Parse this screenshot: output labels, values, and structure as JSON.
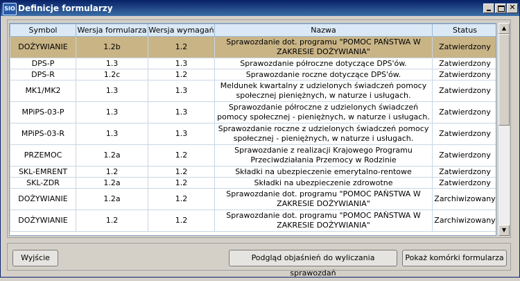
{
  "window": {
    "title": "Definicje formularzy",
    "icon": "SIO"
  },
  "table": {
    "columns": [
      "Symbol",
      "Wersja formularza",
      "Wersja wymagań",
      "Nazwa",
      "Status"
    ],
    "rows": [
      {
        "symbol": "DOŻYWIANIE",
        "wf": "1.2b",
        "ww": "1.2",
        "name": "Sprawozdanie dot. programu \"POMOC PAŃSTWA W ZAKRESIE DOŻYWIANIA\"",
        "status": "Zatwierdzony",
        "selected": true
      },
      {
        "symbol": "DPS-P",
        "wf": "1.3",
        "ww": "1.3",
        "name": "Sprawozdanie półroczne dotyczące DPS'ów.",
        "status": "Zatwierdzony"
      },
      {
        "symbol": "DPS-R",
        "wf": "1.2c",
        "ww": "1.2",
        "name": "Sprawozdanie roczne dotyczące DPS'ów.",
        "status": "Zatwierdzony"
      },
      {
        "symbol": "MK1/MK2",
        "wf": "1.3",
        "ww": "1.3",
        "name": "Meldunek kwartalny z udzielonych świadczeń pomocy społecznej pieniężnych, w naturze i usługach.",
        "status": "Zatwierdzony"
      },
      {
        "symbol": "MPiPS-03-P",
        "wf": "1.3",
        "ww": "1.3",
        "name": "Sprawozdanie półroczne z udzielonych świadczeń pomocy społecznej - pieniężnych, w naturze i usługach.",
        "status": "Zatwierdzony"
      },
      {
        "symbol": "MPiPS-03-R",
        "wf": "1.3",
        "ww": "1.3",
        "name": "Sprawozdanie roczne z udzielonych świadczeń pomocy społecznej - pieniężnych, w naturze i usługach.",
        "status": "Zatwierdzony"
      },
      {
        "symbol": "PRZEMOC",
        "wf": "1.2a",
        "ww": "1.2",
        "name": "Sprawozdanie z realizacji Krajowego Programu Przeciwdziałania Przemocy w Rodzinie",
        "status": "Zatwierdzony"
      },
      {
        "symbol": "SKL-EMRENT",
        "wf": "1.2",
        "ww": "1.2",
        "name": "Składki na ubezpieczenie emerytalno-rentowe",
        "status": "Zatwierdzony"
      },
      {
        "symbol": "SKL-ZDR",
        "wf": "1.2a",
        "ww": "1.2",
        "name": "Składki na ubezpieczenie zdrowotne",
        "status": "Zatwierdzony"
      },
      {
        "symbol": "DOŻYWIANIE",
        "wf": "1.2a",
        "ww": "1.2",
        "name": "Sprawozdanie dot. programu \"POMOC PAŃSTWA W ZAKRESIE DOŻYWIANIA\"",
        "status": "Zarchiwizowany"
      },
      {
        "symbol": "DOŻYWIANIE",
        "wf": "1.2",
        "ww": "1.2",
        "name": "Sprawozdanie dot. programu \"POMOC PAŃSTWA W ZAKRESIE DOŻYWIANIA\"",
        "status": "Zarchiwizowany"
      }
    ]
  },
  "buttons": {
    "exit": "Wyjście",
    "preview": "Podgląd objaśnień do wyliczania sprawozdań",
    "cells": "Pokaż komórki formularza"
  },
  "colors": {
    "title_bar": "#0a246a",
    "selected_row": "#c9b486",
    "header_bg": "#dbe9f6"
  }
}
